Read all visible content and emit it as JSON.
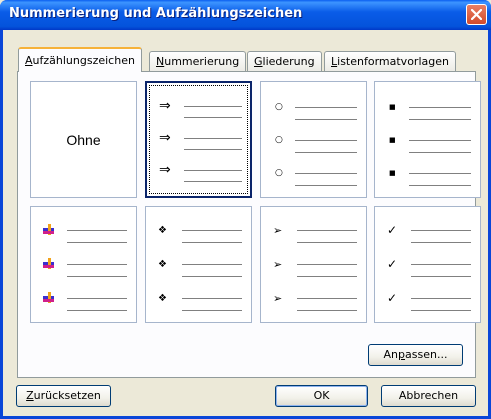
{
  "window": {
    "title": "Nummerierung und Aufzählungszeichen",
    "close_icon": "close-icon"
  },
  "tabs": [
    {
      "pre": "",
      "key": "A",
      "post": "ufzählungszeichen",
      "active": true
    },
    {
      "pre": "",
      "key": "N",
      "post": "ummerierung",
      "active": false
    },
    {
      "pre": "",
      "key": "G",
      "post": "liederung",
      "active": false
    },
    {
      "pre": "",
      "key": "L",
      "post": "istenformatvorlagen",
      "active": false
    }
  ],
  "bullet_styles": [
    {
      "id": "none",
      "label": "Ohne",
      "icon": "none"
    },
    {
      "id": "arrow",
      "glyph": "⇒",
      "icon": "double-arrow-bullet-icon",
      "selected": true
    },
    {
      "id": "circle",
      "glyph": "○",
      "icon": "hollow-circle-bullet-icon"
    },
    {
      "id": "square",
      "glyph": "■",
      "icon": "square-bullet-icon"
    },
    {
      "id": "picture",
      "glyph": "",
      "icon": "picture-bullet-icon"
    },
    {
      "id": "diamond-dots",
      "glyph": "❖",
      "icon": "four-diamond-bullet-icon"
    },
    {
      "id": "arrowhead",
      "glyph": "➢",
      "icon": "arrowhead-bullet-icon"
    },
    {
      "id": "checkmark",
      "glyph": "✓",
      "icon": "checkmark-bullet-icon"
    }
  ],
  "buttons": {
    "customize": {
      "pre": "An",
      "key": "p",
      "post": "assen..."
    },
    "reset": {
      "pre": "",
      "key": "Z",
      "post": "urücksetzen"
    },
    "ok": "OK",
    "cancel": "Abbrechen"
  },
  "colors": {
    "title_bar": "#0a5ce8",
    "active_tab_highlight": "#f6b23a",
    "selection_border": "#0a246a",
    "close_button": "#d24a2a"
  }
}
